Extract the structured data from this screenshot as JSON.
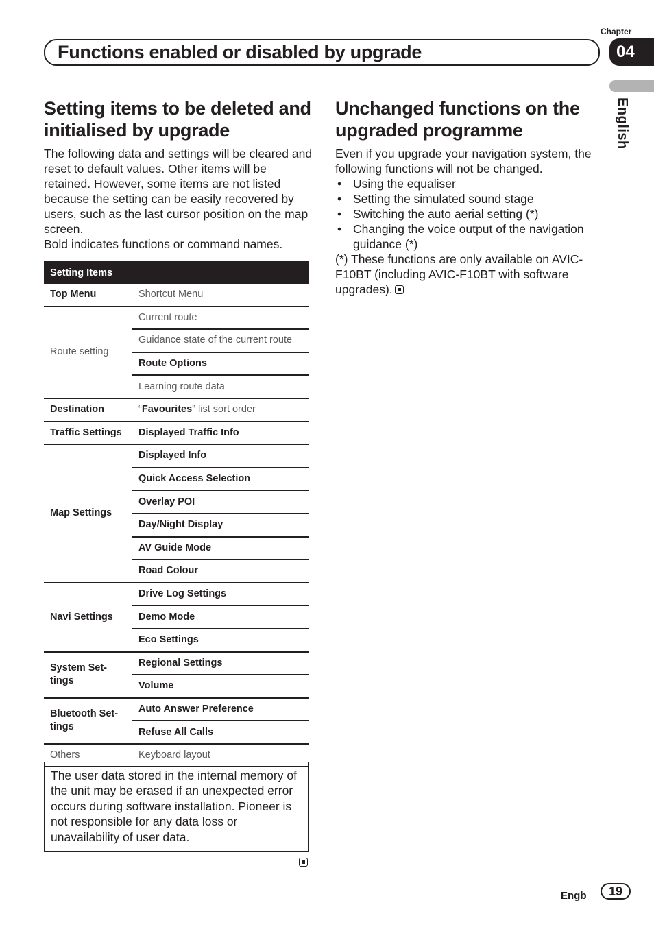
{
  "header": {
    "title": "Functions enabled or disabled by upgrade",
    "chapter_label": "Chapter",
    "chapter_number": "04",
    "language_tab": "English"
  },
  "left": {
    "heading": "Setting items to be deleted and initialised by upgrade",
    "intro": "The following data and settings will be cleared and reset to default values. Other items will be retained. However, some items are not listed because the setting can be easily recovered by users, such as the last cursor position on the map screen.",
    "bold_note": "Bold indicates functions or command names.",
    "table": {
      "header": "Setting Items",
      "groups": [
        {
          "category": "Top Menu",
          "category_bold": true,
          "items": [
            {
              "text": "Shortcut Menu",
              "bold": false
            }
          ]
        },
        {
          "category": "Route setting",
          "category_bold": false,
          "items": [
            {
              "text": "Current route",
              "bold": false
            },
            {
              "text": "Guidance state of the current route",
              "bold": false
            },
            {
              "text": "Route Options",
              "bold": true
            },
            {
              "text": "Learning route data",
              "bold": false
            }
          ]
        },
        {
          "category": "Destination",
          "category_bold": true,
          "items": [
            {
              "text_bold_part": "Favourites",
              "text_prefix": "“",
              "text_suffix": "” list sort order",
              "mixed": true
            }
          ]
        },
        {
          "category": "Traffic Settings",
          "category_bold": true,
          "items": [
            {
              "text": "Displayed Traffic Info",
              "bold": true
            }
          ]
        },
        {
          "category": "Map Settings",
          "category_bold": true,
          "items": [
            {
              "text": "Displayed Info",
              "bold": true
            },
            {
              "text": "Quick Access Selection",
              "bold": true
            },
            {
              "text": "Overlay POI",
              "bold": true
            },
            {
              "text": "Day/Night Display",
              "bold": true
            },
            {
              "text": "AV Guide Mode",
              "bold": true
            },
            {
              "text": "Road Colour",
              "bold": true
            }
          ]
        },
        {
          "category": "Navi Settings",
          "category_bold": true,
          "items": [
            {
              "text": "Drive Log Settings",
              "bold": true
            },
            {
              "text": "Demo Mode",
              "bold": true
            },
            {
              "text": "Eco Settings",
              "bold": true
            }
          ]
        },
        {
          "category": "System Set-\ntings",
          "category_bold": true,
          "items": [
            {
              "text": "Regional Settings",
              "bold": true
            },
            {
              "text": "Volume",
              "bold": true
            }
          ]
        },
        {
          "category": "Bluetooth Set-\ntings",
          "category_bold": true,
          "items": [
            {
              "text": "Auto Answer Preference",
              "bold": true
            },
            {
              "text": "Refuse All Calls",
              "bold": true
            }
          ]
        },
        {
          "category": "Others",
          "category_bold": false,
          "items": [
            {
              "text": "Keyboard layout",
              "bold": false
            }
          ]
        }
      ]
    },
    "note": "The user data stored in the internal memory of the unit may be erased if an unexpected error occurs during software installation. Pioneer is not responsible for any data loss or unavailability of user data."
  },
  "right": {
    "heading": "Unchanged functions on the upgraded programme",
    "intro": "Even if you upgrade your navigation system, the following functions will not be changed.",
    "bullets": [
      "Using the equaliser",
      "Setting the simulated sound stage",
      "Switching the auto aerial setting (*)",
      "Changing the voice output of the navigation guidance (*)"
    ],
    "footnote": "(*) These functions are only available on AVIC-F10BT (including AVIC-F10BT with software upgrades)."
  },
  "footer": {
    "language_code": "Engb",
    "page_number": "19"
  }
}
